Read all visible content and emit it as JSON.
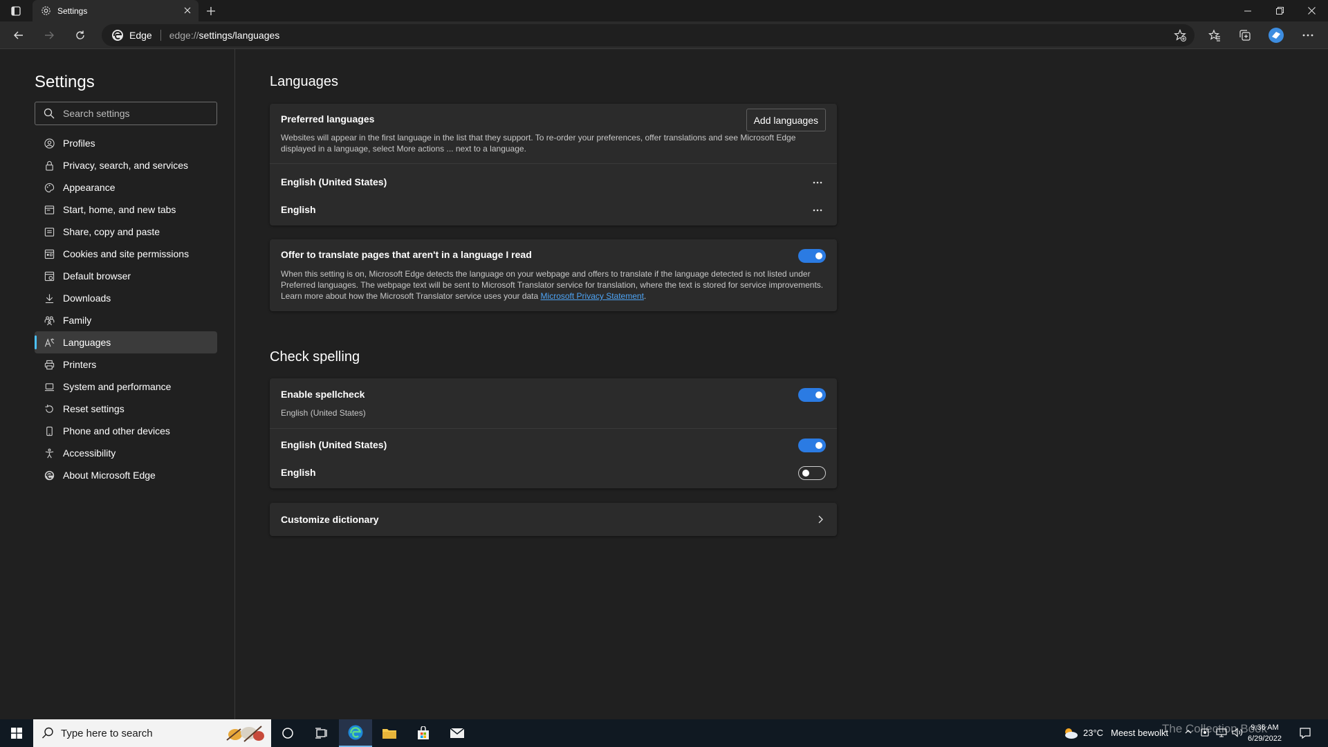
{
  "browser": {
    "tab_title": "Settings",
    "site_label": "Edge",
    "url_scheme": "edge://",
    "url_path": "settings/languages",
    "accent": "#4cc2ff"
  },
  "sidebar": {
    "title": "Settings",
    "search_placeholder": "Search settings",
    "items": [
      {
        "label": "Profiles",
        "icon": "profile-icon"
      },
      {
        "label": "Privacy, search, and services",
        "icon": "lock-icon"
      },
      {
        "label": "Appearance",
        "icon": "palette-icon"
      },
      {
        "label": "Start, home, and new tabs",
        "icon": "home-tabs-icon"
      },
      {
        "label": "Share, copy and paste",
        "icon": "share-icon"
      },
      {
        "label": "Cookies and site permissions",
        "icon": "cookies-icon"
      },
      {
        "label": "Default browser",
        "icon": "default-browser-icon"
      },
      {
        "label": "Downloads",
        "icon": "download-icon"
      },
      {
        "label": "Family",
        "icon": "family-icon"
      },
      {
        "label": "Languages",
        "icon": "languages-icon",
        "active": true
      },
      {
        "label": "Printers",
        "icon": "printer-icon"
      },
      {
        "label": "System and performance",
        "icon": "laptop-icon"
      },
      {
        "label": "Reset settings",
        "icon": "reset-icon"
      },
      {
        "label": "Phone and other devices",
        "icon": "phone-icon"
      },
      {
        "label": "Accessibility",
        "icon": "accessibility-icon"
      },
      {
        "label": "About Microsoft Edge",
        "icon": "edge-logo-icon"
      }
    ]
  },
  "languages": {
    "title": "Languages",
    "preferred": {
      "title": "Preferred languages",
      "add_button": "Add languages",
      "description": "Websites will appear in the first language in the list that they support. To re-order your preferences, offer translations and see Microsoft Edge displayed in a language, select More actions ... next to a language.",
      "list": [
        "English (United States)",
        "English"
      ]
    },
    "translate": {
      "title": "Offer to translate pages that aren't in a language I read",
      "description": "When this setting is on, Microsoft Edge detects the language on your webpage and offers to translate if the language detected is not listed under Preferred languages. The webpage text will be sent to Microsoft Translator service for translation, where the text is stored for service improvements. Learn more about how the Microsoft Translator service uses your data",
      "link": "Microsoft Privacy Statement",
      "link_suffix": ".",
      "enabled": true
    }
  },
  "spelling": {
    "title": "Check spelling",
    "enable": {
      "title": "Enable spellcheck",
      "subtitle": "English (United States)",
      "enabled": true
    },
    "langs": [
      {
        "label": "English (United States)",
        "enabled": true
      },
      {
        "label": "English",
        "enabled": false
      }
    ],
    "customize": "Customize dictionary"
  },
  "taskbar": {
    "search_placeholder": "Type here to search",
    "weather": "23°C",
    "weather_desc": "Meest bewolkt",
    "time": "9:36 AM",
    "date": "6/29/2022",
    "watermark": "The Collection Book"
  }
}
